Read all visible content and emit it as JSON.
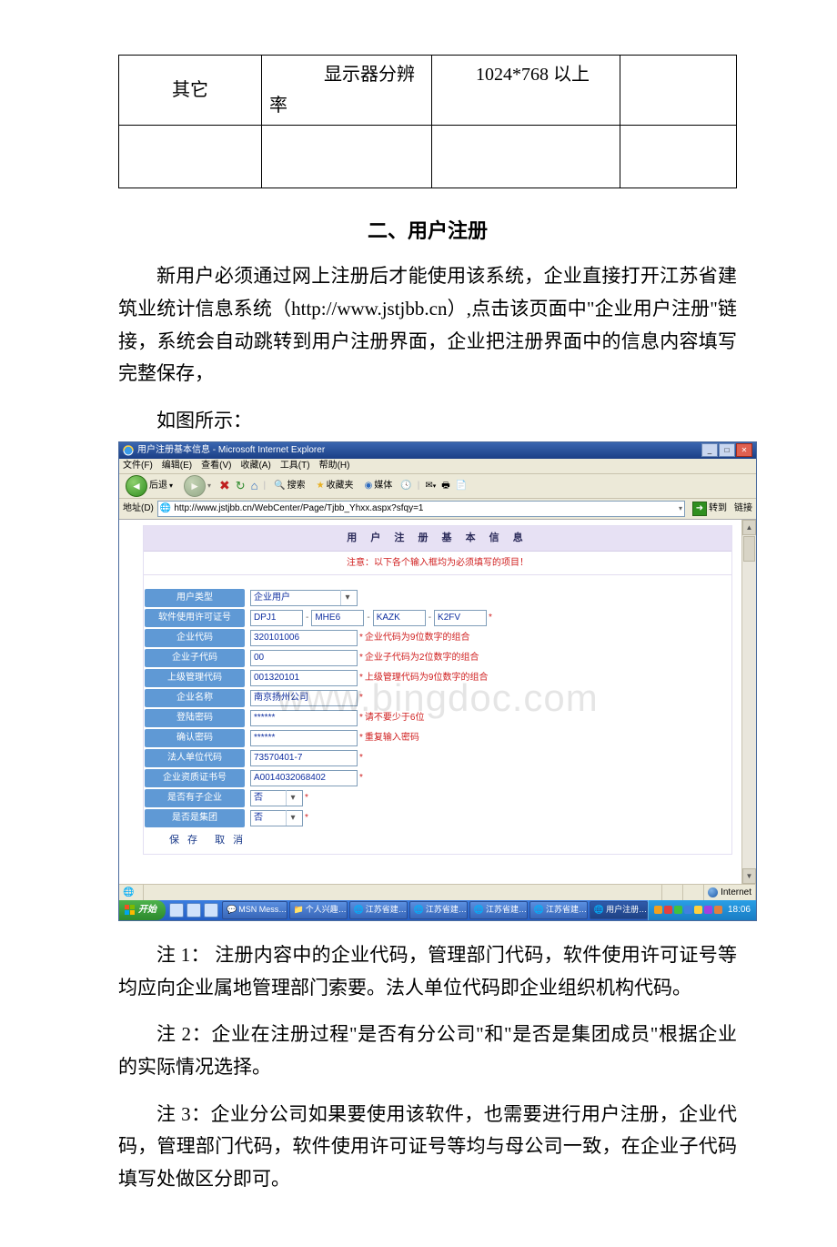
{
  "req_table": {
    "c1": "其它",
    "c2": "显示器分辨率",
    "c3": "1024*768 以上"
  },
  "section_title": "二、用户注册",
  "intro": "新用户必须通过网上注册后才能使用该系统，企业直接打开江苏省建筑业统计信息系统（http://www.jstjbb.cn）,点击该页面中\"企业用户注册\"链接，系统会自动跳转到用户注册界面，企业把注册界面中的信息内容填写完整保存，",
  "caption": "如图所示：",
  "notes": {
    "n1": "注 1：  注册内容中的企业代码，管理部门代码，软件使用许可证号等均应向企业属地管理部门索要。法人单位代码即企业组织机构代码。",
    "n2": "注 2：企业在注册过程\"是否有分公司\"和\"是否是集团成员\"根据企业的实际情况选择。",
    "n3": "注 3：企业分公司如果要使用该软件，也需要进行用户注册，企业代码，管理部门代码，软件使用许可证号等均与母公司一致，在企业子代码填写处做区分即可。"
  },
  "watermark": "www.bingdoc.com",
  "ie": {
    "title": "用户注册基本信息 - Microsoft Internet Explorer",
    "menus": [
      "文件(F)",
      "编辑(E)",
      "查看(V)",
      "收藏(A)",
      "工具(T)",
      "帮助(H)"
    ],
    "toolbar": {
      "back": "后退",
      "search": "搜索",
      "fav": "收藏夹",
      "media": "媒体"
    },
    "addr_label": "地址(D)",
    "addr_value": "http://www.jstjbb.cn/WebCenter/Page/Tjbb_Yhxx.aspx?sfqy=1",
    "go": "转到",
    "links": "链接",
    "form": {
      "title": "用 户 注 册 基 本 信 息",
      "warning": "注意：以下各个输入框均为必须填写的项目！",
      "labels": {
        "userType": "用户类型",
        "license": "软件使用许可证号",
        "code": "企业代码",
        "subcode": "企业子代码",
        "mgrcode": "上级管理代码",
        "name": "企业名称",
        "pwd": "登陆密码",
        "pwd2": "确认密码",
        "legal": "法人单位代码",
        "cert": "企业资质证书号",
        "hassub": "是否有子企业",
        "isgroup": "是否是集团"
      },
      "values": {
        "userType": "企业用户",
        "lic1": "DPJ1",
        "lic2": "MHE6",
        "lic3": "KAZK",
        "lic4": "K2FV",
        "code": "320101006",
        "subcode": "00",
        "mgrcode": "001320101",
        "name": "南京扬州公司",
        "pwd": "******",
        "pwd2": "******",
        "legal": "73570401-7",
        "cert": "A0014032068402",
        "hassub": "否",
        "isgroup": "否"
      },
      "hints": {
        "code": "企业代码为9位数字的组合",
        "subcode": "企业子代码为2位数字的组合",
        "mgrcode": "上级管理代码为9位数字的组合",
        "pwd": "请不要少于6位",
        "pwd2": "重复输入密码"
      },
      "save": "保 存",
      "cancel": "取 消"
    },
    "status_internet": "Internet",
    "taskbar": {
      "start": "开始",
      "tasks": [
        "MSN Mess…",
        "个人兴趣…",
        "江苏省建…",
        "江苏省建…",
        "江苏省建…",
        "江苏省建…",
        "用户注册…"
      ],
      "clock": "18:06"
    }
  }
}
